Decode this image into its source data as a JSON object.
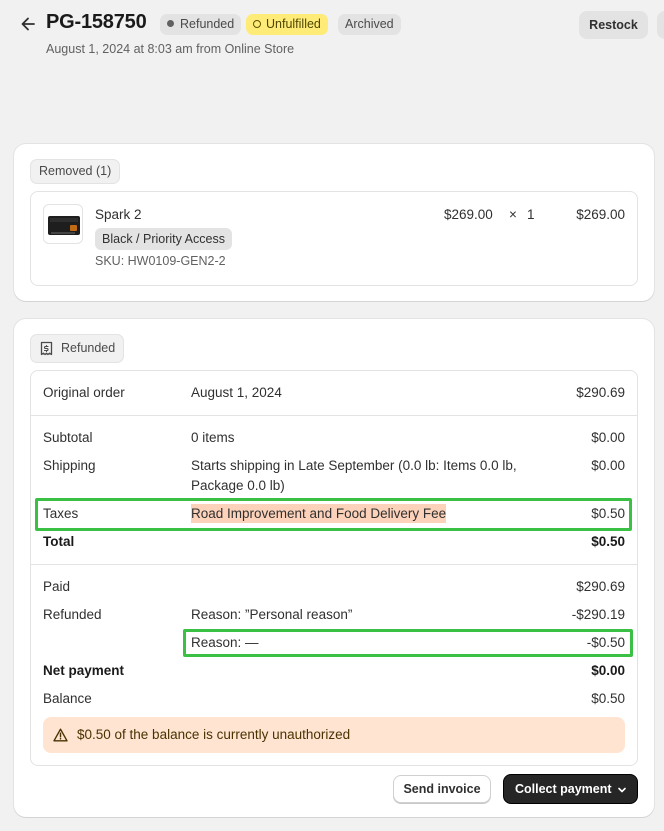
{
  "header": {
    "order_number": "PG-158750",
    "badges": {
      "refunded": "Refunded",
      "unfulfilled": "Unfulfilled",
      "archived": "Archived"
    },
    "subtitle": "August 1, 2024 at 8:03 am from Online Store",
    "restock_label": "Restock"
  },
  "removed_card": {
    "pill_label": "Removed (1)",
    "item": {
      "name": "Spark 2",
      "variant": "Black / Priority Access",
      "sku": "SKU: HW0109-GEN2-2",
      "unit_price": "$269.00",
      "times": "×",
      "quantity": "1",
      "line_total": "$269.00"
    }
  },
  "refunded_card": {
    "pill_label": "Refunded",
    "original_order": {
      "label": "Original order",
      "date": "August 1, 2024",
      "amount": "$290.69"
    },
    "subtotal": {
      "label": "Subtotal",
      "desc": "0 items",
      "amount": "$0.00"
    },
    "shipping": {
      "label": "Shipping",
      "desc_line1": "Starts shipping in Late September (0.0 lb: Items 0.0 lb,",
      "desc_line2": "Package 0.0 lb)",
      "amount": "$0.00"
    },
    "taxes": {
      "label": "Taxes",
      "desc": "Road Improvement and Food Delivery Fee",
      "amount": "$0.50"
    },
    "total": {
      "label": "Total",
      "amount": "$0.50"
    },
    "paid": {
      "label": "Paid",
      "amount": "$290.69"
    },
    "refunded": {
      "label": "Refunded",
      "reason": "Reason: ”Personal reason”",
      "amount": "-$290.19"
    },
    "refunded_2": {
      "reason": "Reason: —",
      "amount": "-$0.50"
    },
    "net_payment": {
      "label": "Net payment",
      "amount": "$0.00"
    },
    "balance": {
      "label": "Balance",
      "amount": "$0.50"
    },
    "warning": "$0.50 of the balance is currently unauthorized",
    "send_invoice_label": "Send invoice",
    "collect_payment_label": "Collect payment"
  },
  "colors": {
    "highlight": "#3ac045",
    "warning_bg": "#ffe4d2",
    "unfulfilled_badge": "#ffeb78",
    "primary_button": "#262626"
  },
  "icons": [
    "arrow-left-icon",
    "receipt-icon",
    "alert-triangle-icon",
    "chevron-down-icon"
  ]
}
